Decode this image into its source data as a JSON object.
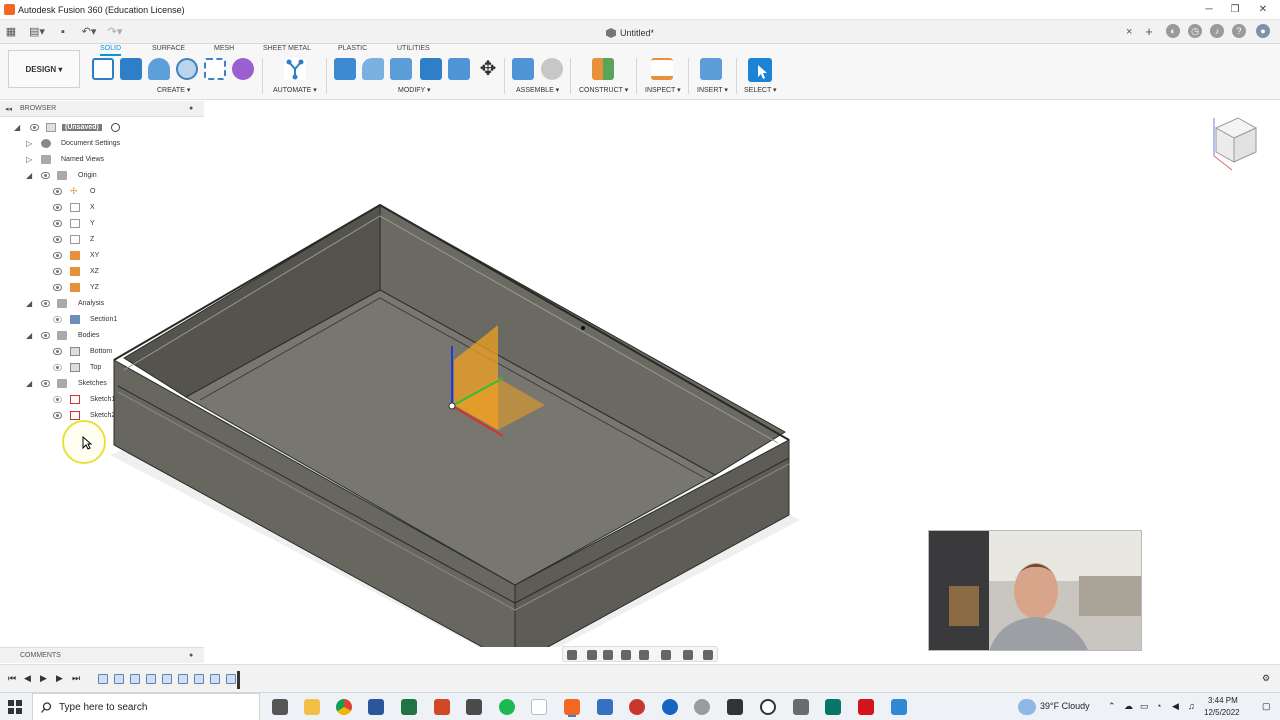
{
  "window": {
    "title": "Autodesk Fusion 360 (Education License)"
  },
  "document_tab": {
    "label": "Untitled*"
  },
  "workspace": {
    "label": "DESIGN ▾"
  },
  "ws_tabs": [
    "SOLID",
    "SURFACE",
    "MESH",
    "SHEET METAL",
    "PLASTIC",
    "UTILITIES"
  ],
  "groups": [
    "CREATE ▾",
    "AUTOMATE ▾",
    "MODIFY ▾",
    "ASSEMBLE ▾",
    "CONSTRUCT ▾",
    "INSPECT ▾",
    "INSERT ▾",
    "SELECT ▾"
  ],
  "browser": {
    "title": "BROWSER",
    "tree": [
      "(Unsaved)",
      "Document Settings",
      "Named Views",
      "Origin",
      "O",
      "X",
      "Y",
      "Z",
      "XY",
      "XZ",
      "YZ",
      "Analysis",
      "Section1",
      "Bodies",
      "Bottom",
      "Top",
      "Sketches",
      "Sketch1",
      "Sketch2"
    ]
  },
  "comments": {
    "title": "COMMENTS"
  },
  "taskbar": {
    "search_placeholder": "Type here to search",
    "weather": "39°F  Cloudy",
    "time": "3:44 PM",
    "date": "12/5/2022"
  },
  "colors": {
    "accent": "#0696d7",
    "body": "#5e5e57",
    "plane": "#f0a020"
  }
}
